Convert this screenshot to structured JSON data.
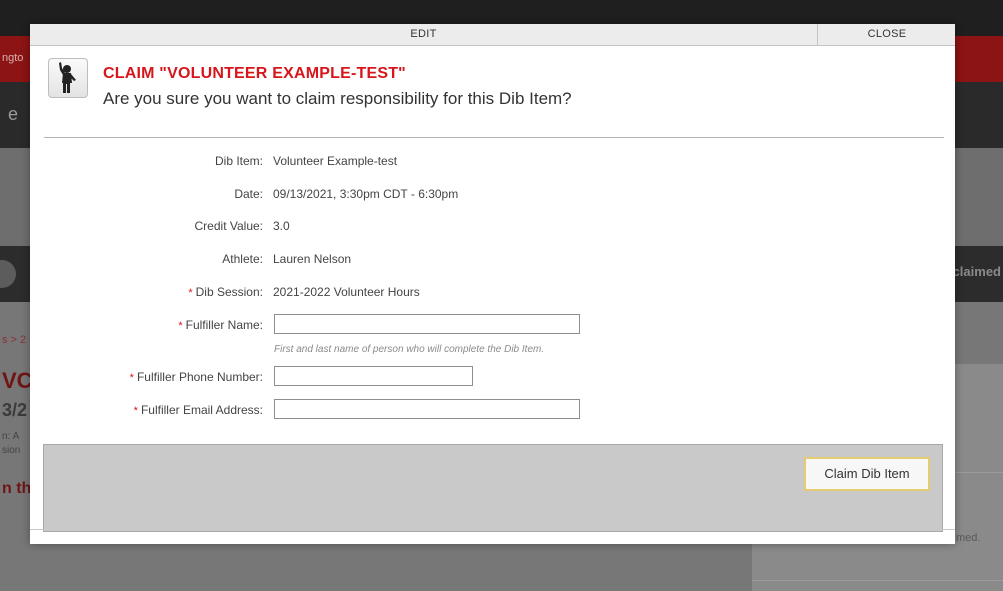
{
  "background": {
    "red_bar_fragment": "ngto",
    "dark_bar_fragment": "e",
    "stripe_right_fragment": "claimed",
    "left_fragments": [
      "s > 2",
      "VC",
      "3/2",
      "n: A",
      "sion",
      "n th"
    ],
    "right_fragment": "med."
  },
  "modal": {
    "title": "EDIT",
    "close_label": "CLOSE",
    "icon": "volunteer-person-icon",
    "claim_title": "CLAIM \"VOLUNTEER EXAMPLE-TEST\"",
    "claim_question": "Are you sure you want to claim responsibility for this Dib Item?"
  },
  "details": {
    "dib_item": {
      "label": "Dib Item:",
      "value": "Volunteer Example-test"
    },
    "date": {
      "label": "Date:",
      "value": "09/13/2021, 3:30pm CDT - 6:30pm"
    },
    "credit_value": {
      "label": "Credit Value:",
      "value": "3.0"
    },
    "athlete": {
      "label": "Athlete:",
      "value": "Lauren Nelson"
    },
    "dib_session": {
      "label": "Dib Session:",
      "value": "2021-2022 Volunteer Hours",
      "required_mark": "*"
    }
  },
  "form": {
    "required_mark": "*",
    "fulfiller_name": {
      "label": "Fulfiller Name:",
      "value": "",
      "hint": "First and last name of person who will complete the Dib Item."
    },
    "fulfiller_phone": {
      "label": "Fulfiller Phone Number:",
      "value": ""
    },
    "fulfiller_email": {
      "label": "Fulfiller Email Address:",
      "value": ""
    }
  },
  "footer": {
    "claim_button_label": "Claim Dib Item"
  },
  "colors": {
    "accent_red": "#d7151b",
    "button_border": "#e5cc70"
  }
}
